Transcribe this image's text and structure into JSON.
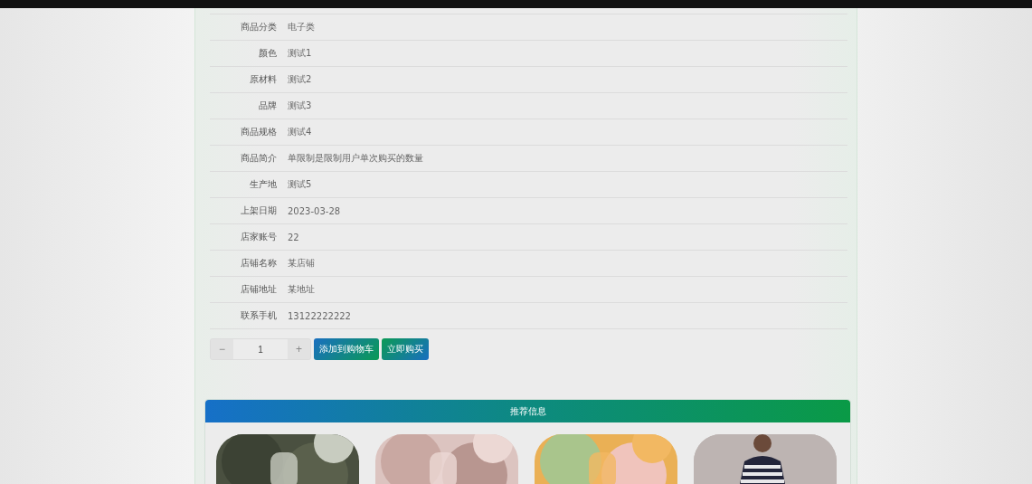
{
  "details": [
    {
      "label": "商品分类",
      "value": "电子类"
    },
    {
      "label": "颜色",
      "value": "测试1"
    },
    {
      "label": "原材料",
      "value": "测试2"
    },
    {
      "label": "品牌",
      "value": "测试3"
    },
    {
      "label": "商品规格",
      "value": "测试4"
    },
    {
      "label": "商品简介",
      "value": "单限制是限制用户单次购买的数量"
    },
    {
      "label": "生产地",
      "value": "测试5"
    },
    {
      "label": "上架日期",
      "value": "2023-03-28"
    },
    {
      "label": "店家账号",
      "value": "22"
    },
    {
      "label": "店铺名称",
      "value": "某店铺"
    },
    {
      "label": "店铺地址",
      "value": "某地址"
    },
    {
      "label": "联系手机",
      "value": "13122222222"
    }
  ],
  "quantity": {
    "minus": "−",
    "value": "1",
    "plus": "+"
  },
  "buttons": [
    "添加到购物车",
    "立即购买"
  ],
  "recommend": {
    "title": "推荐信息"
  }
}
